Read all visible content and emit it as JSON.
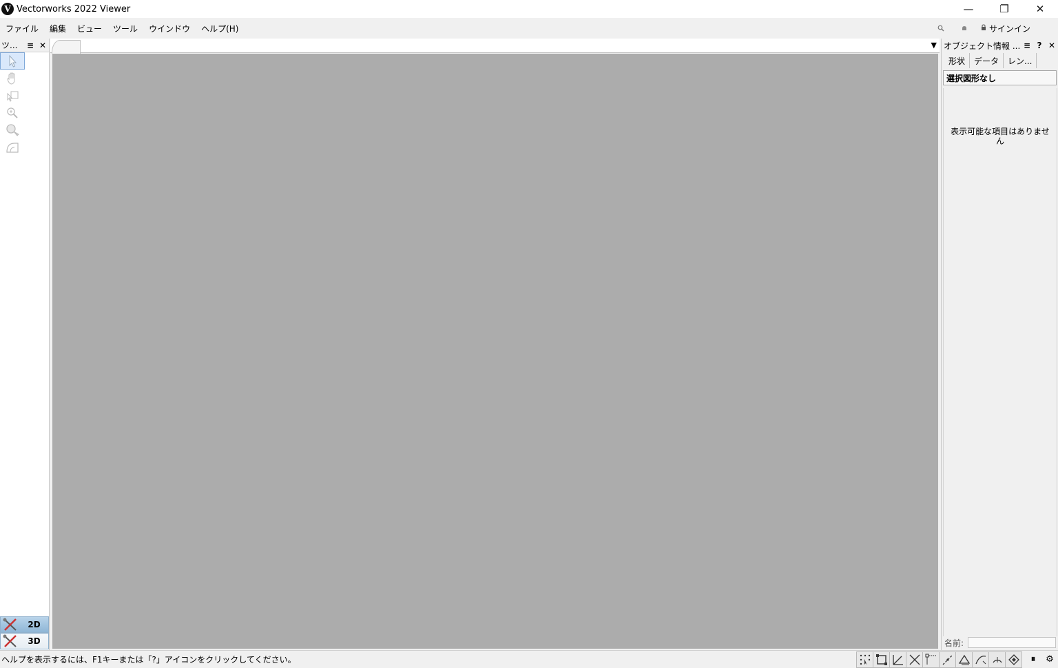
{
  "window": {
    "title": "Vectorworks 2022 Viewer",
    "logo_letter": "V",
    "minimize_glyph": "—",
    "restore_glyph": "❐",
    "close_glyph": "✕"
  },
  "menubar": {
    "items": [
      "ファイル",
      "編集",
      "ビュー",
      "ツール",
      "ウインドウ",
      "ヘルプ(H)"
    ],
    "sign_in_label": "サインイン"
  },
  "tool_palette": {
    "title": "ツ...",
    "menu_glyph": "≡",
    "close_glyph": "✕",
    "tools": [
      {
        "icon": "select-arrow-icon",
        "selected": true
      },
      {
        "icon": "pan-hand-icon",
        "selected": false
      },
      {
        "icon": "flyover-icon",
        "selected": false
      },
      {
        "icon": "zoom-icon",
        "selected": false
      },
      {
        "icon": "walkthrough-icon",
        "selected": false
      },
      {
        "icon": "protractor-icon",
        "selected": false
      }
    ],
    "sets": [
      {
        "label": "2D",
        "active": true
      },
      {
        "label": "3D",
        "active": false
      }
    ]
  },
  "document": {
    "tab_menu_glyph": "▼",
    "canvas_color": "#acacac"
  },
  "oip": {
    "title": "オブジェクト情報 ...",
    "menu_glyph": "≡",
    "help_glyph": "?",
    "close_glyph": "✕",
    "tabs": [
      "形状",
      "データ",
      "レン..."
    ],
    "selection_status": "選択図形なし",
    "empty_message": "表示可能な項目はありません",
    "name_label": "名前:"
  },
  "statusbar": {
    "help_text": "ヘルプを表示するには、F1キーまたは「?」アイコンをクリックしてください。",
    "pause_glyph": "⏸",
    "settings_glyph": "⚙",
    "snaps": [
      "snap-grid-icon",
      "snap-object-icon",
      "snap-angle-icon",
      "snap-intersection-icon",
      "snap-distance-icon",
      "snap-tangent-icon",
      "smart-edge-icon",
      "smart-point-icon",
      "snap-arc-icon",
      "snap-surface-icon"
    ]
  }
}
